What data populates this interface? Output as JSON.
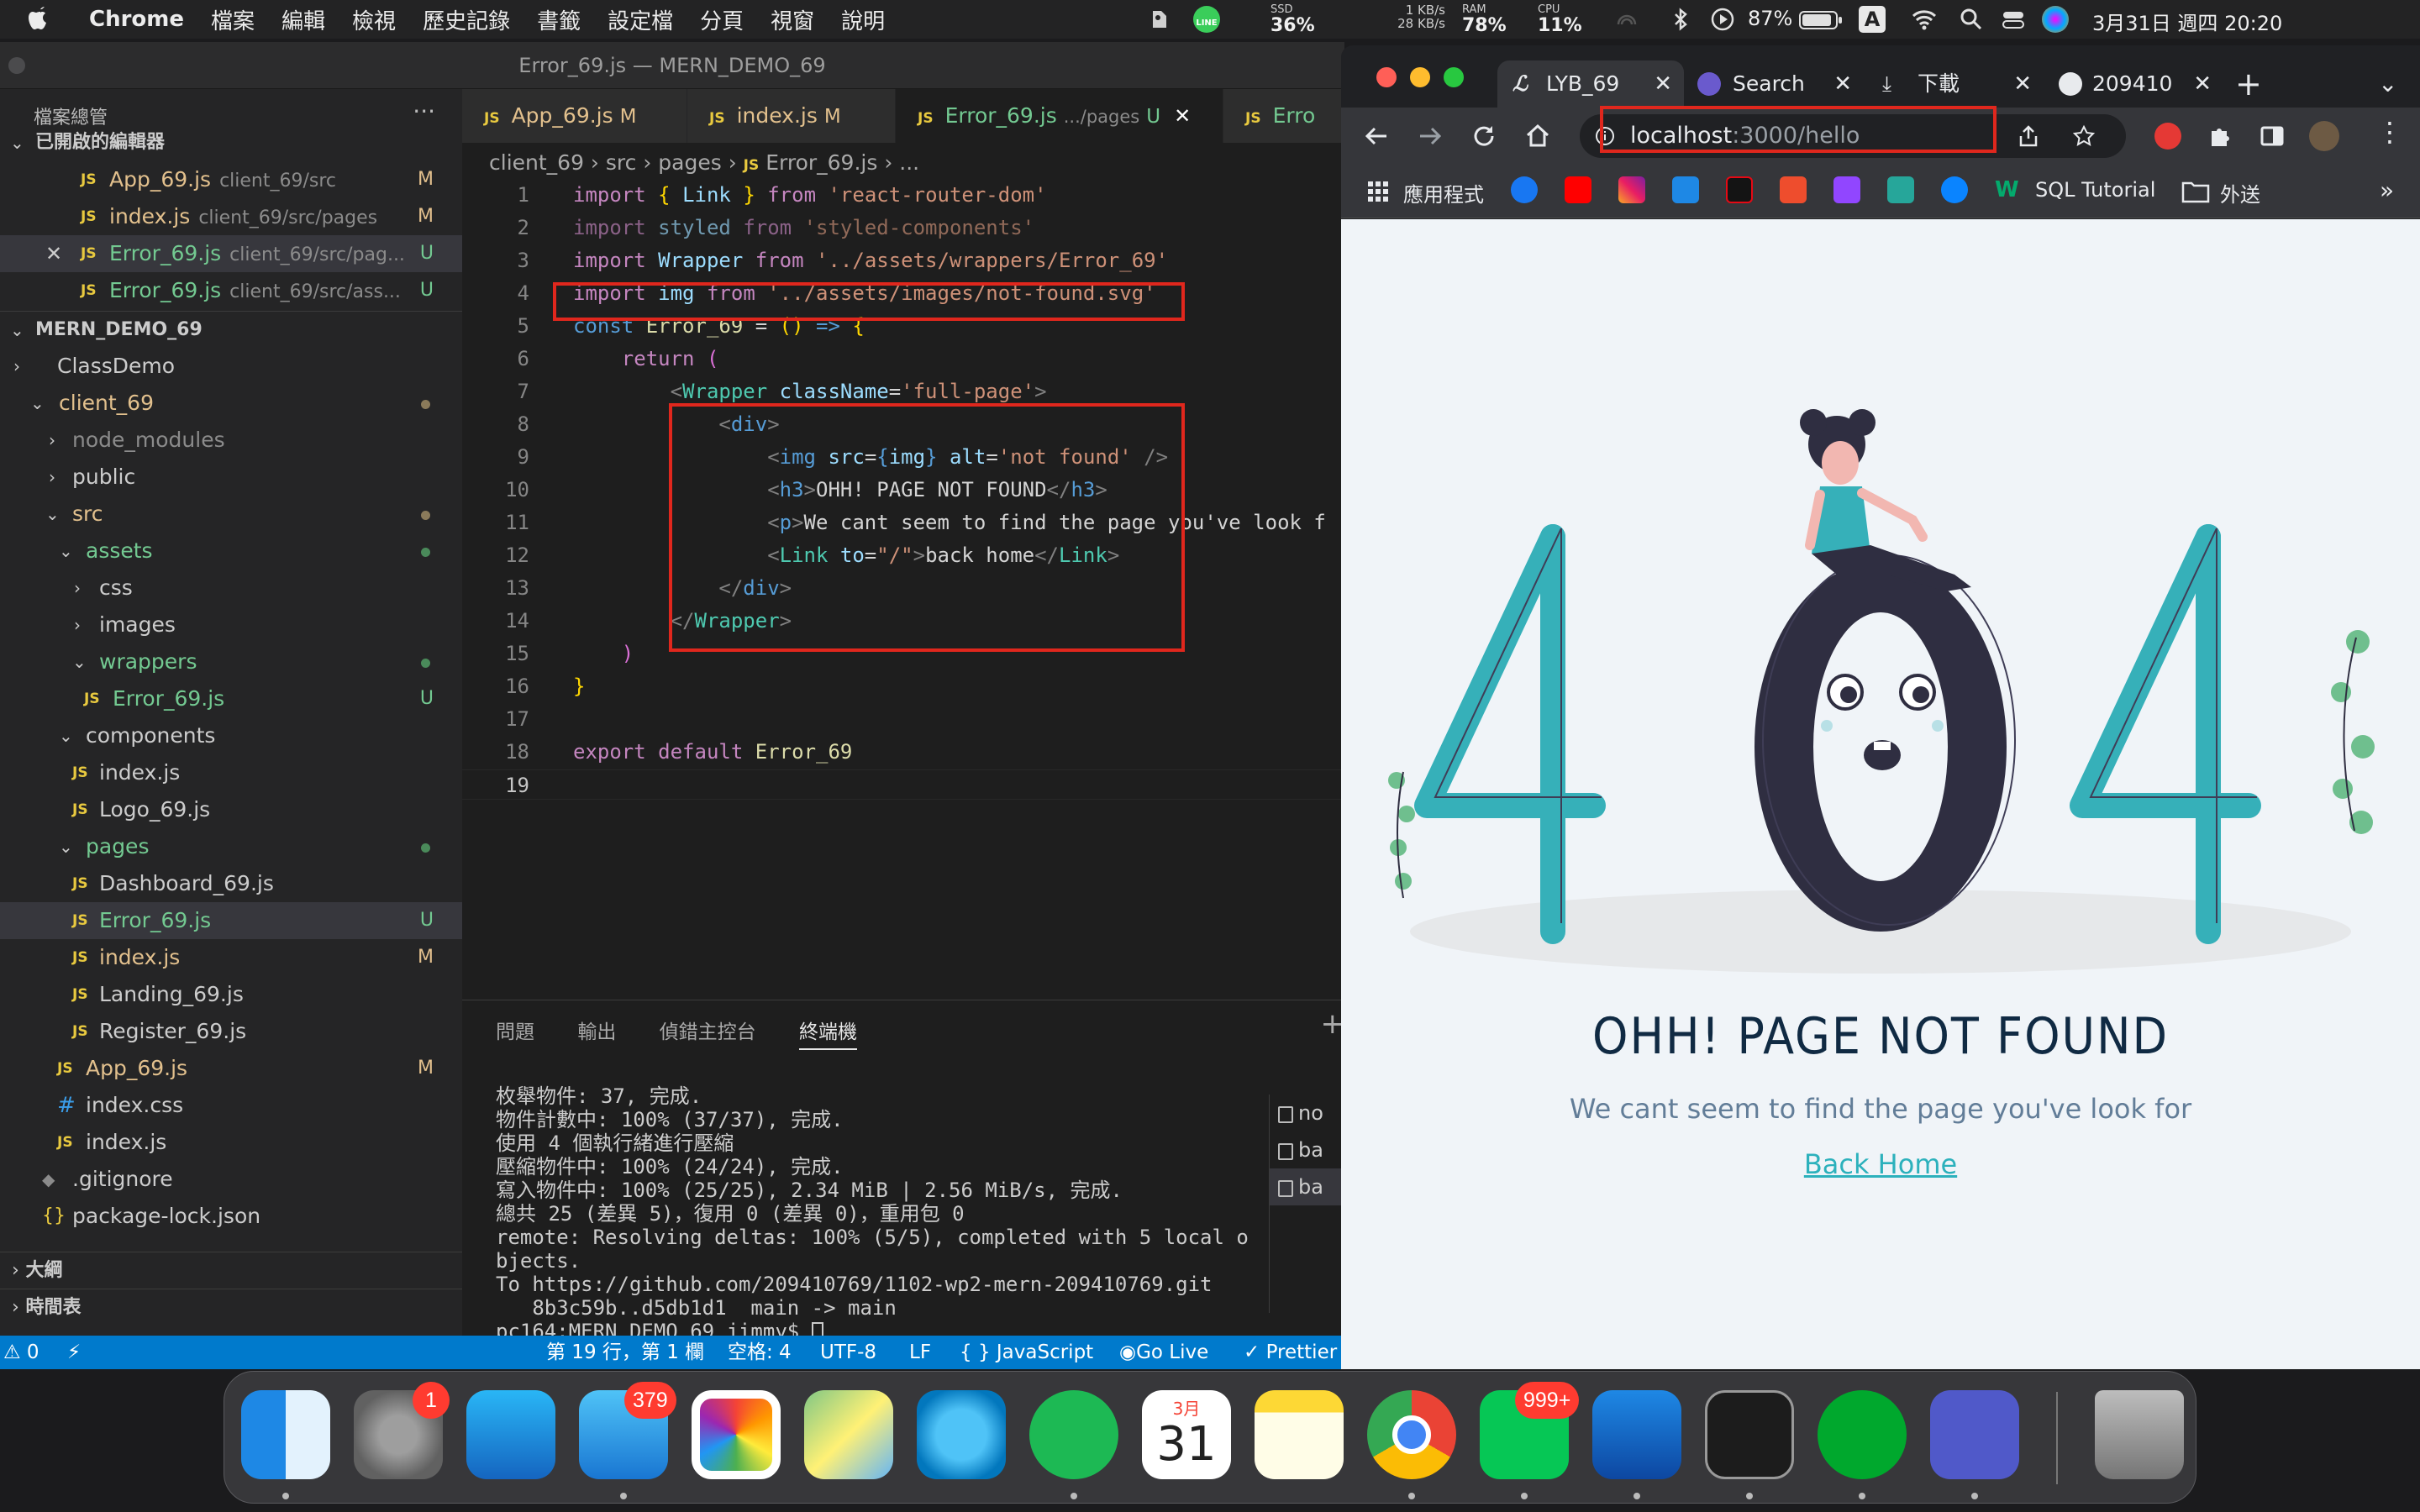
{
  "menubar": {
    "app": "Chrome",
    "items": [
      "檔案",
      "編輯",
      "檢視",
      "歷史記錄",
      "書籤",
      "設定檔",
      "分頁",
      "視窗",
      "說明"
    ],
    "net_up": "1 KB/s",
    "net_down": "28 KB/s",
    "ssd_label": "SSD",
    "ssd_value": "36%",
    "ram_label": "RAM",
    "ram_value": "78%",
    "cpu_label": "CPU",
    "cpu_value": "11%",
    "battery": "87%",
    "input_method": "A",
    "datetime": "3月31日 週四 20:20",
    "line_label": "LINE"
  },
  "vscode": {
    "window_title": "Error_69.js — MERN_DEMO_69",
    "explorer_title": "檔案總管",
    "more": "···",
    "open_editors_title": "已開啟的編輯器",
    "open_editors": [
      {
        "name": "App_69.js",
        "path": "client_69/src",
        "badge": "M"
      },
      {
        "name": "index.js",
        "path": "client_69/src/pages",
        "badge": "M"
      },
      {
        "name": "Error_69.js",
        "path": "client_69/src/pag...",
        "badge": "U"
      },
      {
        "name": "Error_69.js",
        "path": "client_69/src/ass...",
        "badge": "U"
      }
    ],
    "project_title": "MERN_DEMO_69",
    "tree": [
      {
        "label": "ClassDemo"
      },
      {
        "label": "client_69"
      },
      {
        "label": "node_modules"
      },
      {
        "label": "public"
      },
      {
        "label": "src"
      },
      {
        "label": "assets"
      },
      {
        "label": "css"
      },
      {
        "label": "images"
      },
      {
        "label": "wrappers"
      },
      {
        "label": "Error_69.js",
        "badge": "U"
      },
      {
        "label": "components"
      },
      {
        "label": "index.js"
      },
      {
        "label": "Logo_69.js"
      },
      {
        "label": "pages"
      },
      {
        "label": "Dashboard_69.js"
      },
      {
        "label": "Error_69.js",
        "badge": "U"
      },
      {
        "label": "index.js",
        "badge": "M"
      },
      {
        "label": "Landing_69.js"
      },
      {
        "label": "Register_69.js"
      },
      {
        "label": "App_69.js",
        "badge": "M"
      },
      {
        "label": "index.css"
      },
      {
        "label": "index.js"
      },
      {
        "label": ".gitignore"
      },
      {
        "label": "package-lock.json"
      }
    ],
    "outline_title": "大綱",
    "timeline_title": "時間表",
    "tabs": [
      {
        "name": "App_69.js",
        "flag": "M"
      },
      {
        "name": "index.js",
        "flag": "M"
      },
      {
        "name": "Error_69.js",
        "sub": ".../pages",
        "flag": "U",
        "close": "✕"
      },
      {
        "name": "Erro"
      }
    ],
    "breadcrumb": [
      "client_69",
      "src",
      "pages",
      "Error_69.js",
      "..."
    ],
    "line_numbers": [
      "1",
      "2",
      "3",
      "4",
      "5",
      "6",
      "7",
      "8",
      "9",
      "10",
      "11",
      "12",
      "13",
      "14",
      "15",
      "16",
      "17",
      "18",
      "19"
    ],
    "panel_tabs": [
      "問題",
      "輸出",
      "偵錯主控台",
      "終端機"
    ],
    "terminal_lines": [
      "枚舉物件: 37, 完成.",
      "物件計數中: 100% (37/37), 完成.",
      "使用 4 個執行緒進行壓縮",
      "壓縮物件中: 100% (24/24), 完成.",
      "寫入物件中: 100% (25/25), 2.34 MiB | 2.56 MiB/s, 完成.",
      "總共 25 (差異 5)，復用 0 (差異 0)，重用包 0",
      "remote: Resolving deltas: 100% (5/5), completed with 5 local o",
      "bjects.",
      "To https://github.com/209410769/1102-wp2-mern-209410769.git",
      "   8b3c59b..d5db1d1  main -> main"
    ],
    "terminal_prompt": "pc164:MERN_DEMO_69 jimmy$ ",
    "terminal_list": [
      "no",
      "ba",
      "ba"
    ],
    "status": {
      "errors": "⚠ 0",
      "sync": "⚡",
      "position": "第 19 行，第 1 欄",
      "spaces": "空格: 4",
      "encoding": "UTF-8",
      "eol": "LF",
      "language": "{ } JavaScript",
      "golive": "Go Live",
      "prettier": "✓ Prettier"
    }
  },
  "chrome": {
    "tabs": [
      {
        "title": "LYB_69",
        "close": "✕"
      },
      {
        "title": "Search",
        "close": "✕"
      },
      {
        "title": "下載",
        "close": "✕"
      },
      {
        "title": "209410",
        "close": "✕"
      }
    ],
    "new_tab": "+",
    "tab_menu": "⌄",
    "url_host": "localhost",
    "url_path": ":3000/hello",
    "bookmarks": {
      "apps": "應用程式",
      "sql": "SQL Tutorial",
      "folder": "外送",
      "more": "»"
    },
    "page": {
      "img_alt": "not found",
      "title": "OHH! PAGE NOT FOUND",
      "text": "We cant seem to find the page you've look for",
      "link": "Back Home"
    }
  },
  "dock": {
    "apps": [
      "Finder",
      "System Preferences",
      "App Store",
      "Mail",
      "Photos",
      "Maps",
      "Safari",
      "Spotify",
      "Calendar",
      "Notes",
      "Chrome",
      "LINE",
      "VS Code",
      "Terminal",
      "Evernote",
      "Teams",
      "Trash"
    ],
    "badges": {
      "system_preferences": "1",
      "mail": "379",
      "line": "999+"
    },
    "calendar_month": "3月",
    "calendar_day": "31"
  }
}
